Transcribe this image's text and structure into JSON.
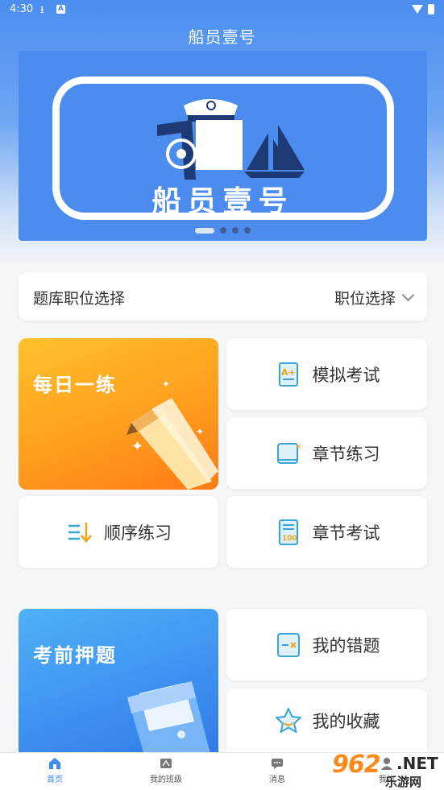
{
  "status": {
    "time": "4:30",
    "a_badge": "A"
  },
  "app_title": "船员壹号",
  "banner": {
    "logo_text": "船员壹号",
    "dot_count": 4,
    "active_dot": 0
  },
  "job_select": {
    "label": "题库职位选择",
    "value": "职位选择"
  },
  "promo_daily": {
    "text": "每日一练"
  },
  "promo_exam": {
    "text": "考前押题"
  },
  "cards": {
    "mock_exam": "模拟考试",
    "chapter_practice": "章节练习",
    "sequential_practice": "顺序练习",
    "chapter_exam": "章节考试",
    "my_mistakes": "我的错题",
    "my_favorites": "我的收藏"
  },
  "tabs": [
    {
      "label": "首页",
      "icon": "home-icon",
      "active": true
    },
    {
      "label": "我的班级",
      "icon": "class-icon",
      "active": false
    },
    {
      "label": "消息",
      "icon": "message-icon",
      "active": false
    },
    {
      "label": "我的",
      "icon": "user-icon",
      "active": false
    }
  ],
  "watermark": {
    "num": "962",
    "net": ".NET",
    "sub": "乐游网"
  },
  "colors": {
    "primary": "#4a8ef0",
    "orange": "#ff9b1e",
    "blue_promo": "#3d8ff0"
  }
}
